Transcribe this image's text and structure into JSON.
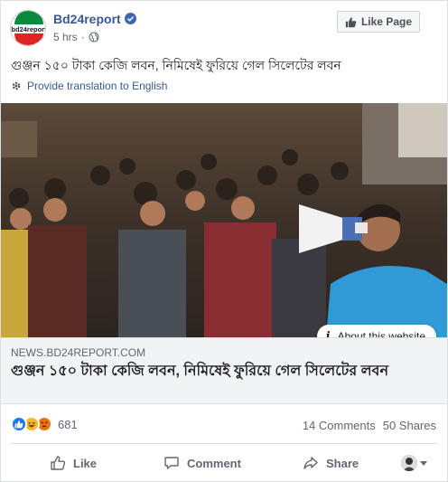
{
  "header": {
    "page_name": "Bd24report",
    "logo_text": "bd24report",
    "time": "5 hrs",
    "separator": "·",
    "like_page_label": "Like Page"
  },
  "post": {
    "text": "গুঞ্জন ১৫০ টাকা কেজি লবন, নিমিষেই ফুরিয়ে গেল সিলেটের লবন",
    "translate_label": "Provide translation to English"
  },
  "image": {
    "about_label": "About this website"
  },
  "link": {
    "domain": "NEWS.BD24REPORT.COM",
    "title": "গুঞ্জন ১৫০ টাকা কেজি লবন, নিমিষেই ফুরিয়ে গেল সিলেটের লবন"
  },
  "engagement": {
    "reaction_count": "681",
    "comments": "14 Comments",
    "shares": "50 Shares",
    "reactions": [
      "like",
      "haha",
      "angry"
    ]
  },
  "actions": {
    "like": "Like",
    "comment": "Comment",
    "share": "Share"
  },
  "colors": {
    "link_blue": "#385898",
    "like_blue": "#1877f2",
    "logo_green": "#0a8a3f",
    "logo_red": "#e02424"
  }
}
